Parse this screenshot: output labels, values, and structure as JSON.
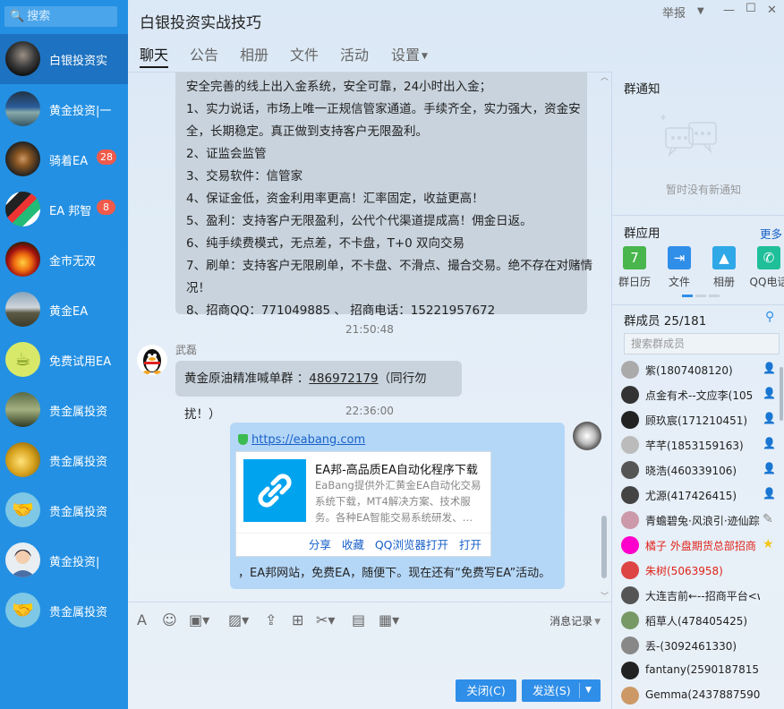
{
  "sidebar": {
    "search_placeholder": "搜索",
    "conversations": [
      {
        "name": "白银投资实",
        "badge": "",
        "active": true
      },
      {
        "name": "黄金投资|一",
        "badge": ""
      },
      {
        "name": "骑着EA",
        "badge": "28"
      },
      {
        "name": "EA 邦智",
        "badge": "8"
      },
      {
        "name": "金市无双",
        "badge": ""
      },
      {
        "name": "黄金EA",
        "badge": ""
      },
      {
        "name": "免费试用EA",
        "badge": ""
      },
      {
        "name": "贵金属投资",
        "badge": ""
      },
      {
        "name": "贵金属投资",
        "badge": ""
      },
      {
        "name": "贵金属投资",
        "badge": ""
      },
      {
        "name": "黄金投资|",
        "badge": ""
      },
      {
        "name": "贵金属投资",
        "badge": ""
      }
    ]
  },
  "header": {
    "title": "白银投资实战技巧",
    "report": "举报",
    "tabs": [
      "聊天",
      "公告",
      "相册",
      "文件",
      "活动",
      "设置"
    ]
  },
  "chat": {
    "notice_lines": [
      "安全完善的线上出入金系统，安全可靠，24小时出入金；",
      "1、实力说话，市场上唯一正规信管家通道。手续齐全，实力强大，资金安",
      "全，长期稳定。真正做到支持客户无限盈利。",
      "2、证监会监管",
      "3、交易软件：信管家",
      "4、保证金低，资金利用率更高！汇率固定，收益更高！",
      "5、盈利：支持客户无限盈利，公代个代渠道提成高！佣金日返。",
      "6、纯手续费模式，无点差，不卡盘，T+0 双向交易",
      "7、刷单：支持客户无限刷单，不卡盘、不滑点、撮合交易。绝不存在对赌情",
      "况！",
      "8、招商QQ：771049885 、 招商电话：15221957672"
    ],
    "time1": "21:50:48",
    "sender": "武磊",
    "msg2_prefix": "黄金原油精准喊单群 ：",
    "msg2_number": "486972179",
    "msg2_suffix": "（同行勿扰！）",
    "time2": "22:36:00",
    "link": "https://eabang.com",
    "card_title": "EA邦-高品质EA自动化程序下载",
    "card_desc": "EaBang提供外汇黄金EA自动化交易系统下载，MT4解决方案、技术服务。各种EA智能交易系统研发、…",
    "card_actions": [
      "分享",
      "收藏",
      "QQ浏览器打开",
      "打开"
    ],
    "tail": "，EA邦网站，免费EA，随便下。现在还有“免费写EA”活动。"
  },
  "toolbar": {
    "history": "消息记录",
    "close": "关闭(C)",
    "send": "发送(S)"
  },
  "right": {
    "notice_title": "群通知",
    "notice_empty": "暂时没有新通知",
    "apps_title": "群应用",
    "more": "更多",
    "apps": [
      {
        "label": "群日历",
        "color": "#48b64c",
        "icon": "calendar-icon"
      },
      {
        "label": "文件",
        "color": "#2f8ee8",
        "icon": "upload-icon"
      },
      {
        "label": "相册",
        "color": "#2fa8e8",
        "icon": "picture-icon"
      },
      {
        "label": "QQ电话",
        "color": "#1fbf9a",
        "icon": "phone-icon"
      }
    ],
    "members_title": "群成员 25/181",
    "member_search": "搜索群成员",
    "members": [
      {
        "name": "紫(1807408120)",
        "color": "#222"
      },
      {
        "name": "点金有术--文应李(105",
        "color": "#222"
      },
      {
        "name": "顾玖宸(171210451)",
        "color": "#222"
      },
      {
        "name": "芊芊(1853159163)",
        "color": "#222"
      },
      {
        "name": "晓浩(460339106)",
        "color": "#222"
      },
      {
        "name": "尤源(417426415)",
        "color": "#222"
      },
      {
        "name": "青蟾碧兔·风浪引·迹仙踪",
        "color": "#222"
      },
      {
        "name": "橘子  外盘期货总部招商",
        "color": "#e0241a"
      },
      {
        "name": "朱树(5063958)",
        "color": "#e0241a"
      },
      {
        "name": "大连吉前←--招商平台<wujia",
        "color": "#222"
      },
      {
        "name": "稻草人(478405425)",
        "color": "#222"
      },
      {
        "name": "丢-(3092461330)",
        "color": "#222"
      },
      {
        "name": "fantany(2590187815)",
        "color": "#222"
      },
      {
        "name": "Gemma(2437887590)",
        "color": "#222"
      }
    ]
  }
}
